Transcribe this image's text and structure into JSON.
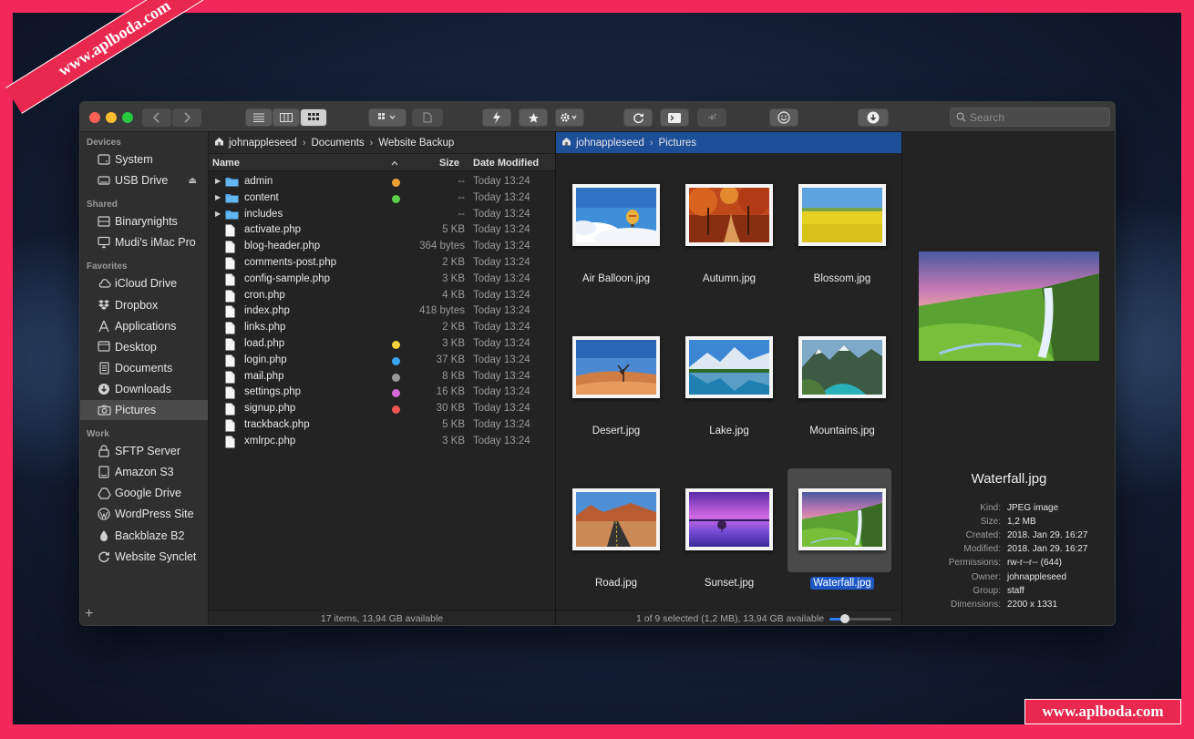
{
  "watermark": {
    "top": "www.aplboda.com",
    "bottom": "www.aplboda.com"
  },
  "toolbar": {
    "search_placeholder": "Search"
  },
  "sidebar": {
    "sections": [
      {
        "title": "Devices",
        "items": [
          {
            "label": "System",
            "icon": "hard-drive-icon"
          },
          {
            "label": "USB Drive",
            "icon": "usb-drive-icon",
            "eject": "⏏"
          }
        ]
      },
      {
        "title": "Shared",
        "items": [
          {
            "label": "Binarynights",
            "icon": "server-icon"
          },
          {
            "label": "Mudi’s iMac Pro",
            "icon": "imac-icon"
          }
        ]
      },
      {
        "title": "Favorites",
        "items": [
          {
            "label": "iCloud Drive",
            "icon": "cloud-icon"
          },
          {
            "label": "Dropbox",
            "icon": "dropbox-icon"
          },
          {
            "label": "Applications",
            "icon": "applications-icon"
          },
          {
            "label": "Desktop",
            "icon": "desktop-icon"
          },
          {
            "label": "Documents",
            "icon": "documents-icon"
          },
          {
            "label": "Downloads",
            "icon": "downloads-icon"
          },
          {
            "label": "Pictures",
            "icon": "camera-icon",
            "selected": true
          }
        ]
      },
      {
        "title": "Work",
        "items": [
          {
            "label": "SFTP Server",
            "icon": "lock-icon"
          },
          {
            "label": "Amazon S3",
            "icon": "amazon-s3-icon"
          },
          {
            "label": "Google Drive",
            "icon": "google-drive-icon"
          },
          {
            "label": "WordPress Site",
            "icon": "wordpress-icon"
          },
          {
            "label": "Backblaze B2",
            "icon": "backblaze-icon"
          },
          {
            "label": "Website Synclet",
            "icon": "sync-icon"
          }
        ]
      }
    ],
    "add_symbol": "+"
  },
  "left_pane": {
    "breadcrumb": [
      "johnappleseed",
      "Documents",
      "Website Backup"
    ],
    "columns": {
      "name": "Name",
      "size": "Size",
      "date": "Date Modified"
    },
    "files": [
      {
        "name": "admin",
        "folder": true,
        "tag": "#f0a030",
        "size": "--",
        "date": "Today 13:24"
      },
      {
        "name": "content",
        "folder": true,
        "tag": "#5ccf4a",
        "size": "--",
        "date": "Today 13:24"
      },
      {
        "name": "includes",
        "folder": true,
        "tag": "",
        "size": "--",
        "date": "Today 13:24"
      },
      {
        "name": "activate.php",
        "folder": false,
        "tag": "",
        "size": "5 KB",
        "date": "Today 13:24"
      },
      {
        "name": "blog-header.php",
        "folder": false,
        "tag": "",
        "size": "364 bytes",
        "date": "Today 13:24"
      },
      {
        "name": "comments-post.php",
        "folder": false,
        "tag": "",
        "size": "2 KB",
        "date": "Today 13:24"
      },
      {
        "name": "config-sample.php",
        "folder": false,
        "tag": "",
        "size": "3 KB",
        "date": "Today 13:24"
      },
      {
        "name": "cron.php",
        "folder": false,
        "tag": "",
        "size": "4 KB",
        "date": "Today 13:24"
      },
      {
        "name": "index.php",
        "folder": false,
        "tag": "",
        "size": "418 bytes",
        "date": "Today 13:24"
      },
      {
        "name": "links.php",
        "folder": false,
        "tag": "",
        "size": "2 KB",
        "date": "Today 13:24"
      },
      {
        "name": "load.php",
        "folder": false,
        "tag": "#f2d03a",
        "size": "3 KB",
        "date": "Today 13:24"
      },
      {
        "name": "login.php",
        "folder": false,
        "tag": "#3aa4f0",
        "size": "37 KB",
        "date": "Today 13:24"
      },
      {
        "name": "mail.php",
        "folder": false,
        "tag": "#9a9a9a",
        "size": "8 KB",
        "date": "Today 13:24"
      },
      {
        "name": "settings.php",
        "folder": false,
        "tag": "#d46ad8",
        "size": "16 KB",
        "date": "Today 13:24"
      },
      {
        "name": "signup.php",
        "folder": false,
        "tag": "#ec5550",
        "size": "30 KB",
        "date": "Today 13:24"
      },
      {
        "name": "trackback.php",
        "folder": false,
        "tag": "",
        "size": "5 KB",
        "date": "Today 13:24"
      },
      {
        "name": "xmlrpc.php",
        "folder": false,
        "tag": "",
        "size": "3 KB",
        "date": "Today 13:24"
      }
    ],
    "status": "17 items, 13,94 GB available"
  },
  "right_pane": {
    "breadcrumb": [
      "johnappleseed",
      "Pictures"
    ],
    "images": [
      {
        "name": "Air Balloon.jpg",
        "scene": "balloon"
      },
      {
        "name": "Autumn.jpg",
        "scene": "autumn"
      },
      {
        "name": "Blossom.jpg",
        "scene": "blossom"
      },
      {
        "name": "Desert.jpg",
        "scene": "desert"
      },
      {
        "name": "Lake.jpg",
        "scene": "lake"
      },
      {
        "name": "Mountains.jpg",
        "scene": "mountains"
      },
      {
        "name": "Road.jpg",
        "scene": "road"
      },
      {
        "name": "Sunset.jpg",
        "scene": "sunset"
      },
      {
        "name": "Waterfall.jpg",
        "scene": "waterfall",
        "selected": true
      }
    ],
    "status": "1 of 9 selected (1,2 MB), 13,94 GB available",
    "zoom_level": 0.25
  },
  "preview": {
    "name": "Waterfall.jpg",
    "meta": [
      {
        "k": "Kind:",
        "v": "JPEG image"
      },
      {
        "k": "Size:",
        "v": "1,2 MB"
      },
      {
        "k": "Created:",
        "v": "2018. Jan 29. 16:27"
      },
      {
        "k": "Modified:",
        "v": "2018. Jan 29. 16:27"
      },
      {
        "k": "Permissions:",
        "v": "rw-r--r-- (644)"
      },
      {
        "k": "Owner:",
        "v": "johnappleseed"
      },
      {
        "k": "Group:",
        "v": "staff"
      },
      {
        "k": "Dimensions:",
        "v": "2200 x 1331"
      }
    ]
  }
}
